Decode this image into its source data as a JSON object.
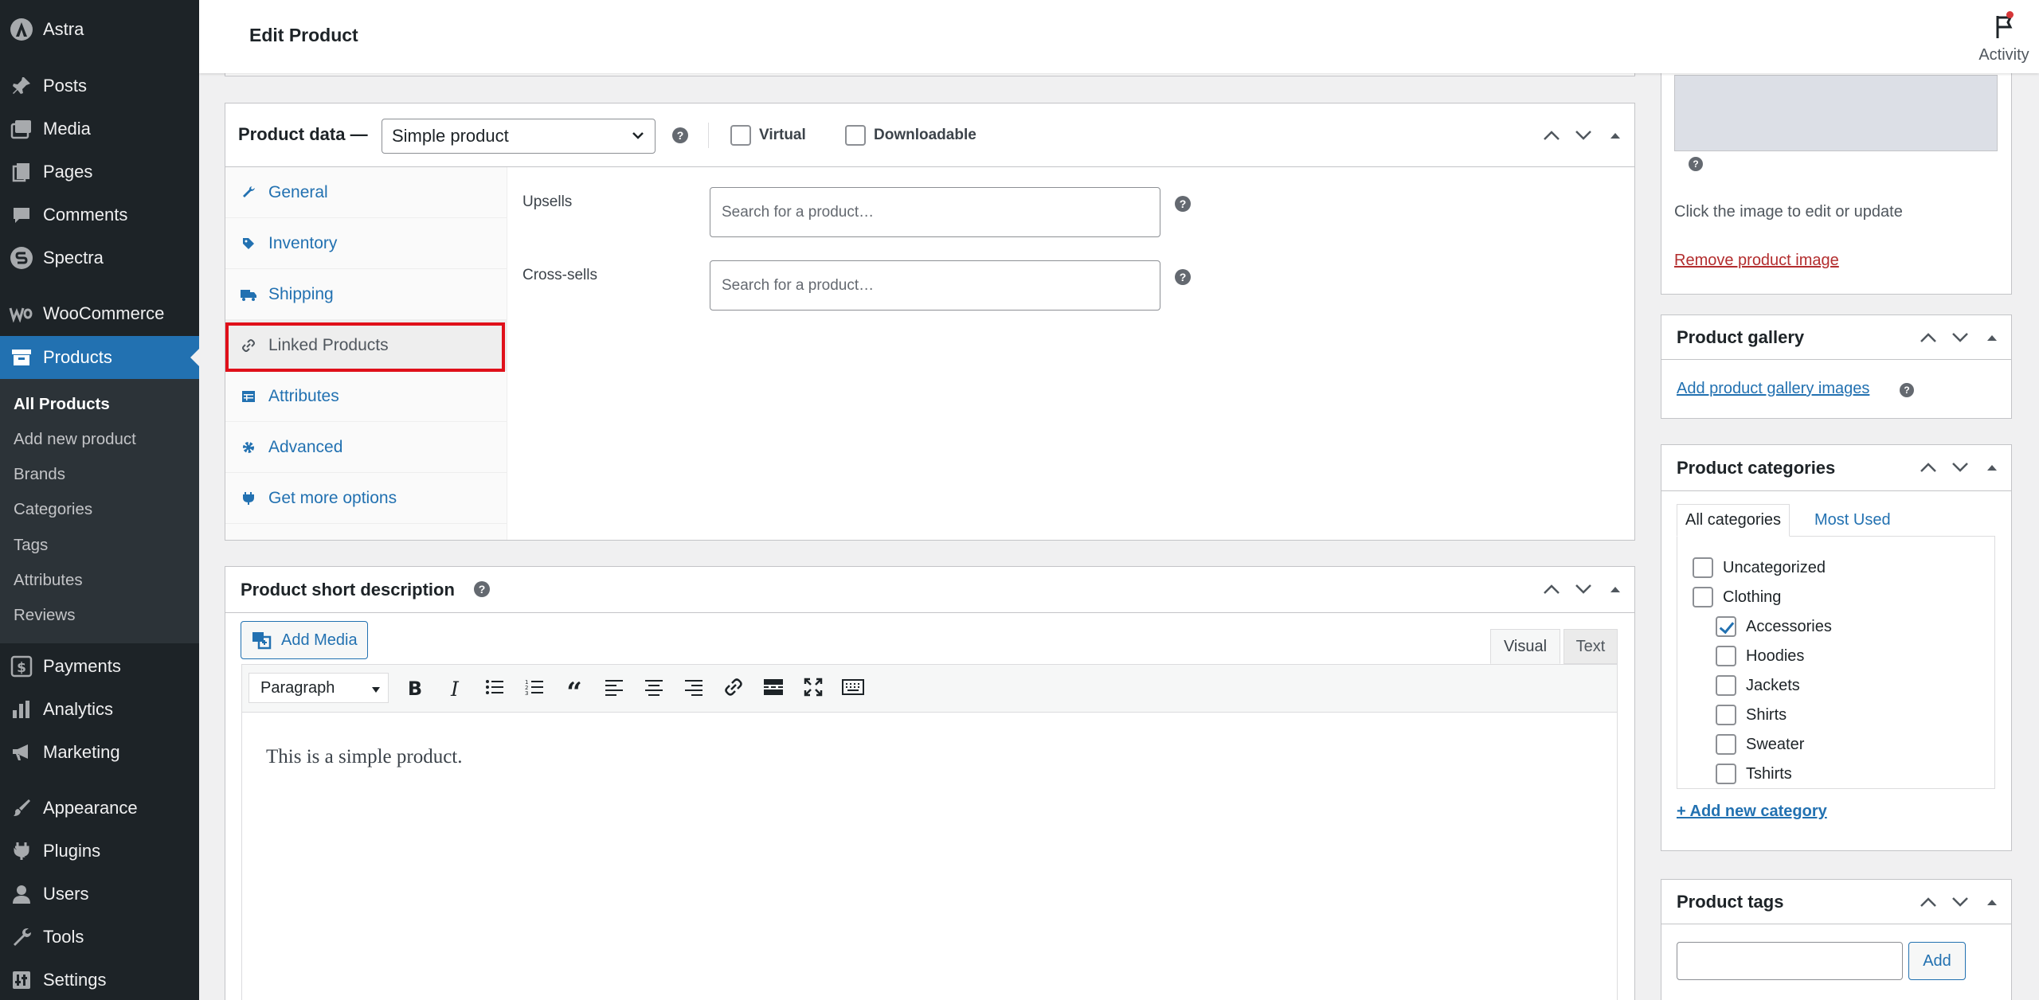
{
  "sidebar": {
    "site_name": "Astra",
    "items": [
      {
        "label": "Posts",
        "icon": "pin-icon"
      },
      {
        "label": "Media",
        "icon": "media-icon"
      },
      {
        "label": "Pages",
        "icon": "pages-icon"
      },
      {
        "label": "Comments",
        "icon": "comment-icon"
      },
      {
        "label": "Spectra",
        "icon": "spectra-icon"
      },
      {
        "label": "WooCommerce",
        "icon": "woo-icon"
      },
      {
        "label": "Products",
        "icon": "archive-icon"
      },
      {
        "label": "Payments",
        "icon": "dollar-icon"
      },
      {
        "label": "Analytics",
        "icon": "bar-chart-icon"
      },
      {
        "label": "Marketing",
        "icon": "megaphone-icon"
      },
      {
        "label": "Appearance",
        "icon": "brush-icon"
      },
      {
        "label": "Plugins",
        "icon": "plug-icon"
      },
      {
        "label": "Users",
        "icon": "user-icon"
      },
      {
        "label": "Tools",
        "icon": "wrench-icon"
      },
      {
        "label": "Settings",
        "icon": "settings-icon"
      }
    ],
    "submenu": [
      "All Products",
      "Add new product",
      "Brands",
      "Categories",
      "Tags",
      "Attributes",
      "Reviews"
    ]
  },
  "header": {
    "title": "Edit Product",
    "activity": "Activity"
  },
  "product_data": {
    "title": "Product data —",
    "type_select": "Simple product",
    "virtual_label": "Virtual",
    "downloadable_label": "Downloadable",
    "tabs": [
      {
        "label": "General",
        "icon": "wrench-icon"
      },
      {
        "label": "Inventory",
        "icon": "tag-icon"
      },
      {
        "label": "Shipping",
        "icon": "truck-icon"
      },
      {
        "label": "Linked Products",
        "icon": "link-icon"
      },
      {
        "label": "Attributes",
        "icon": "table-icon"
      },
      {
        "label": "Advanced",
        "icon": "gear-icon"
      },
      {
        "label": "Get more options",
        "icon": "plugin-icon"
      }
    ],
    "active_tab": "Linked Products",
    "upsells_label": "Upsells",
    "upsells_placeholder": "Search for a product…",
    "crosssells_label": "Cross-sells",
    "crosssells_placeholder": "Search for a product…"
  },
  "short_description": {
    "title": "Product short description",
    "add_media": "Add Media",
    "tab_visual": "Visual",
    "tab_text": "Text",
    "format_select": "Paragraph",
    "content": "This is a simple product."
  },
  "product_image": {
    "hint": "Click the image to edit or update",
    "remove_link": "Remove product image"
  },
  "product_gallery": {
    "title": "Product gallery",
    "add_link": "Add product gallery images"
  },
  "product_categories": {
    "title": "Product categories",
    "tab_all": "All categories",
    "tab_most_used": "Most Used",
    "categories": [
      {
        "label": "Uncategorized",
        "checked": false,
        "child": false
      },
      {
        "label": "Clothing",
        "checked": false,
        "child": false
      },
      {
        "label": "Accessories",
        "checked": true,
        "child": true
      },
      {
        "label": "Hoodies",
        "checked": false,
        "child": true
      },
      {
        "label": "Jackets",
        "checked": false,
        "child": true
      },
      {
        "label": "Shirts",
        "checked": false,
        "child": true
      },
      {
        "label": "Sweater",
        "checked": false,
        "child": true
      },
      {
        "label": "Tshirts",
        "checked": false,
        "child": true
      }
    ],
    "add_link": "+ Add new category"
  },
  "product_tags": {
    "title": "Product tags",
    "add_button": "Add"
  },
  "colors": {
    "admin_bg": "#1d2327",
    "accent": "#2271b1",
    "highlight": "#e0101a",
    "danger_link": "#b32d2e"
  }
}
